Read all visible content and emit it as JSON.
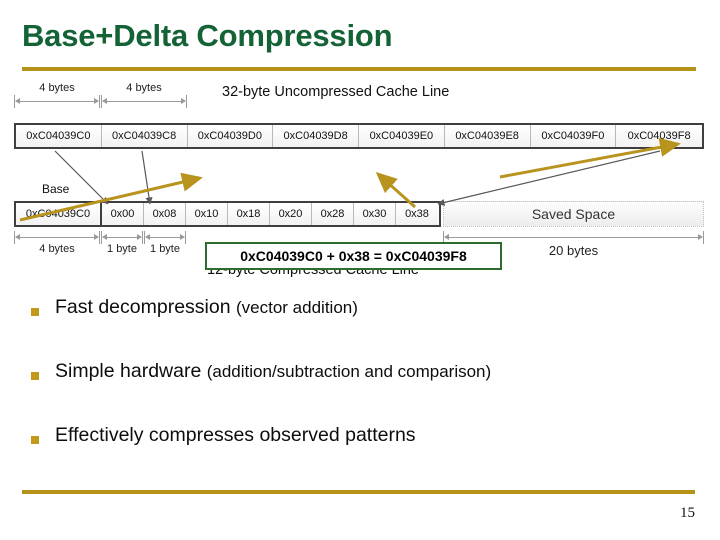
{
  "slide": {
    "title": "Base+Delta Compression",
    "number": "15",
    "accent_color": "#b49318",
    "title_color": "#136336",
    "bullet_color": "#c19a1c",
    "callout_border_color": "#2e6b2e",
    "arrow_color": "#b8941f"
  },
  "diagram": {
    "uncompressed_heading": "32-byte Uncompressed Cache Line",
    "compressed_heading": "12-byte Compressed Cache Line",
    "base_label": "Base",
    "saved_space_label": "Saved Space",
    "saved_space_size": "20 bytes",
    "top_dims": [
      "4 bytes",
      "4 bytes"
    ],
    "bottom_dims": [
      "4 bytes",
      "1 byte",
      "1 byte"
    ],
    "uncompressed_cells": [
      "0xC04039C0",
      "0xC04039C8",
      "0xC04039D0",
      "0xC04039D8",
      "0xC04039E0",
      "0xC04039E8",
      "0xC04039F0",
      "0xC04039F8"
    ],
    "compressed_base": "0xC04039C0",
    "compressed_deltas": [
      "0x00",
      "0x08",
      "0x10",
      "0x18",
      "0x20",
      "0x28",
      "0x30",
      "0x38"
    ],
    "callout": "0xC04039C0 + 0x38 = 0xC04039F8"
  },
  "bullets": [
    {
      "main": "Fast decompression ",
      "paren": "(vector addition)"
    },
    {
      "main": "Simple hardware ",
      "paren": "(addition/subtraction and comparison)"
    },
    {
      "main": "Effectively compresses observed patterns",
      "paren": ""
    }
  ]
}
